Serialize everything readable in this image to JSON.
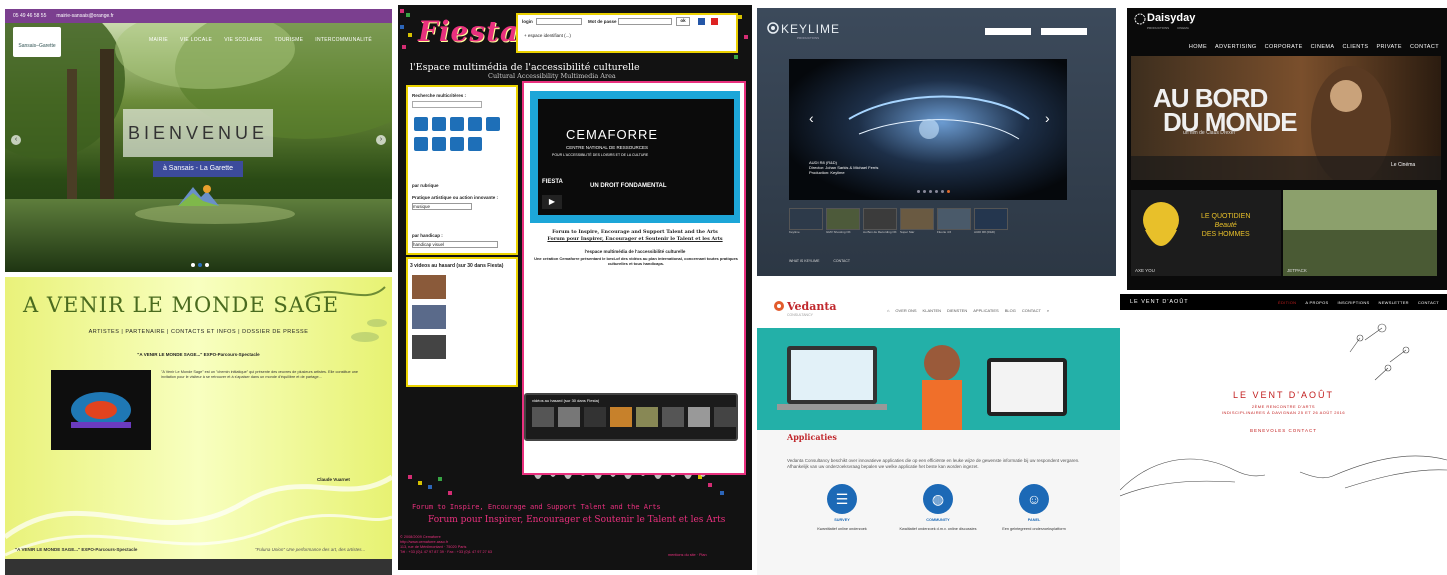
{
  "sansais": {
    "phone": "05 49 46 58 55",
    "email": "mairie-sansais@orange.fr",
    "logo_text": "Sansais–Garette",
    "nav": [
      "MAIRIE",
      "VIE LOCALE",
      "VIE SCOLAIRE",
      "TOURISME",
      "INTERCOMMUNALITÉ"
    ],
    "welcome": "BIENVENUE",
    "subtitle": "à Sansais - La Garette"
  },
  "avenir": {
    "title": "A VENIR LE MONDE SAGE",
    "menu": "ARTISTES  |  PARTENAIRE  |  CONTACTS ET INFOS  |  DOSSIER DE PRESSE",
    "quote": "\"A VENIR LE MONDE SAGE...\" EXPO-Parcours-Spectacle",
    "para": "\"A Venir Le Monde Sage\" est un \"chemin initiatique\" qui présente des œuvres de plusieurs artistes. Elle constitue une invitation pour le visiteur à se retrouver et à s'apaiser dans un monde d'équilibre et de partage...",
    "sign": "Claude Vuarnet",
    "foot_left": "\"A VENIR LE MONDE SAGE...\"  EXPO-Parcours-Spectacle",
    "foot_right": "\"Fuluna Union\" Une performance des art, des artistes..."
  },
  "fiesta": {
    "logo": "Fiesta",
    "login_label": "login",
    "pass_label": "Mot de passe",
    "ok": "ok",
    "espace": "+ espace identifiant (...)",
    "subtitle1": "l'Espace multimédia de l'accessibilité culturelle",
    "subtitle2": "Cultural Accessibility Multimedia Area",
    "search_label": "Recherche multicritères :",
    "by_art": "par rubrique",
    "pratique": "Pratique artistique ou action innovante :",
    "musique": "musique",
    "handicap": "par handicap :",
    "handicap_val": "handicap visuel",
    "random_title": "3 videos au hasard (sur 30 dans Fiesta)",
    "cemaforre": "CEMAFORRE",
    "centre1": "CENTRE NATIONAL DE RESSOURCES",
    "centre2": "POUR L'ACCESSIBILITÉ DES LOISIRS ET DE LA CULTURE",
    "video_title": "FIESTA",
    "video_sub": "UN DROIT FONDAMENTAL",
    "forum_en": "Forum to Inspire, Encourage and Support Talent and the Arts",
    "forum_fr": "Forum pour Inspirer, Encourager et Soutenir le Talent et les Arts",
    "espace_title": "l'espace multimédia de l'accessibilité culturelle",
    "desc": "Une création Cemaforre présentant le best-of des vidéos au plan international, concernant toutes pratiques culturelles et tous handicaps.",
    "thumbs_title": "vidéos au hasard (sur 30 dans Fiesta)",
    "footer_en": "Forum to Inspire, Encourage and Support Talent and the Arts",
    "footer_fr": "Forum pour Inspirer, Encourager et Soutenir le Talent et les Arts",
    "copyright": "© 2008/2009 Cemaforre\nhttp://www.cemaforre.asso.fr\n113, rue de Ménilmontant · 75020 Paris\nTél : +33 (0)1 47 97 87 39 · Fax : +33 (0)1 47 97 27 63",
    "mention": "mentions du site · Plan"
  },
  "keylime": {
    "logo": "KEYLIME",
    "tag": "PRODUCTIONS",
    "cap1": "AUDI R8 (R&D)",
    "cap2": "Director: Johan Sarkis & Michael Ferris",
    "cap3": "Production: Keylime",
    "thumbs": [
      "Keylime",
      "GMV Shooting OK",
      "Au Bon de Recording OK",
      "Super Star",
      "Fluorie 4:6",
      "AUDI R8 (R&D)"
    ],
    "foot": [
      "WHAT IS KEYLIME",
      "CONTACT"
    ]
  },
  "daisyday": {
    "logo": "Daisyday",
    "sublogos": [
      "PRODUCTIONS",
      "CINEMA"
    ],
    "menu": [
      "HOME",
      "ADVERTISING",
      "CORPORATE",
      "CINEMA",
      "CLIENTS",
      "PRIVATE",
      "CONTACT"
    ],
    "hero1": "AU BORD",
    "hero2": "DU MONDE",
    "director": "un film de Claus Drexel",
    "distributor": "Le Cinéma",
    "tile1": "AXE YOU",
    "tile2": "JETPACK",
    "tile1_line1": "LE QUOTIDIEN",
    "tile1_line2": "Beauté",
    "tile1_line3": "DES HOMMES"
  },
  "vedanta": {
    "logo": "Vedanta",
    "slogan": "CONSULTANCY",
    "nav": [
      "OVER ONS",
      "KLANTEN",
      "DIENSTEN",
      "APPLICATIES",
      "BLOG",
      "CONTACT"
    ],
    "title": "Applicaties",
    "desc": "Vedanta Consultancy beschikt over innovatieve applicaties die op een efficiënte en leuke wijze de gewenste informatie bij uw respondent vergaren. Afhankelijk van uw onderzoeksvraag bepalen we welke applicatie het beste kan worden ingezet.",
    "features": [
      {
        "label": "SURVEY",
        "desc": "Kwantitatief online onderzoek"
      },
      {
        "label": "COMMUNITY",
        "desc": "Kwalitatief onderzoek d.m.v. online discussies"
      },
      {
        "label": "PANEL",
        "desc": "Een gelntegreerd onderzoeksplatform"
      }
    ]
  },
  "vent": {
    "brand": "LE VENT D'AOÛT",
    "menu": [
      "ÉDITION",
      "A PROPOS",
      "INSCRIPTIONS",
      "NEWSLETTER",
      "CONTACT"
    ],
    "title": "LE VENT D'AOÛT",
    "sub1": "2ÈME RENCONTRE D'ARTS",
    "sub2": "INDISCIPLINAIRES À DAVIGNAN 25 ET 26 AOÛT 2016",
    "links": "BENEVOLES   CONTACT"
  }
}
